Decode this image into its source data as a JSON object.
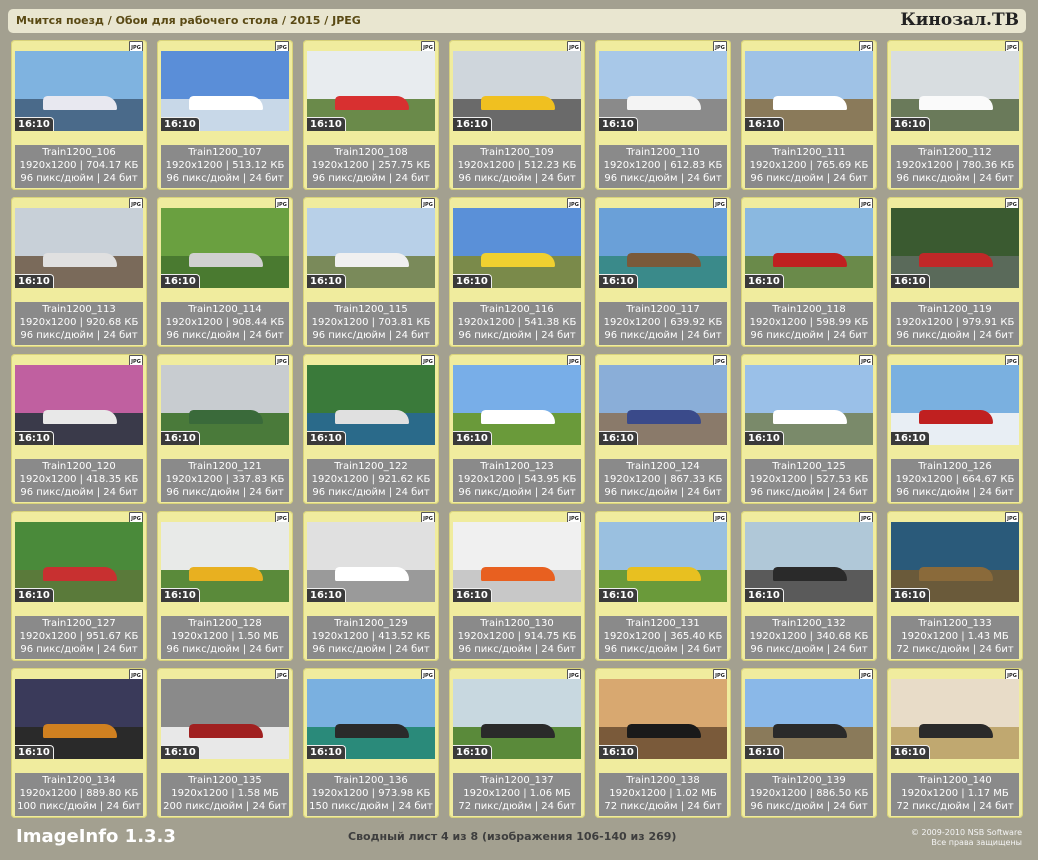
{
  "header": {
    "breadcrumb": "Мчится поезд / Обои для рабочего стола / 2015 / JPEG",
    "brand": "Кинозал.ТВ"
  },
  "tile_common": {
    "aspect_badge": "16:10",
    "format_badge": "JPG"
  },
  "images": [
    {
      "name": "Train1200_106",
      "meta": "1920x1200 | 704.17 КБ",
      "dpi": "96 пикс/дюйм | 24 бит",
      "sky": "#7fb3e0",
      "ground": "#4a6a8a",
      "train": "#e8e8f0"
    },
    {
      "name": "Train1200_107",
      "meta": "1920x1200 | 513.12 КБ",
      "dpi": "96 пикс/дюйм | 24 бит",
      "sky": "#5a8ed8",
      "ground": "#c8d8e8",
      "train": "#ffffff"
    },
    {
      "name": "Train1200_108",
      "meta": "1920x1200 | 257.75 КБ",
      "dpi": "96 пикс/дюйм | 24 бит",
      "sky": "#e8ecef",
      "ground": "#6a8a4a",
      "train": "#d83030"
    },
    {
      "name": "Train1200_109",
      "meta": "1920x1200 | 512.23 КБ",
      "dpi": "96 пикс/дюйм | 24 бит",
      "sky": "#cfd6dc",
      "ground": "#6a6a6a",
      "train": "#f0c020"
    },
    {
      "name": "Train1200_110",
      "meta": "1920x1200 | 612.83 КБ",
      "dpi": "96 пикс/дюйм | 24 бит",
      "sky": "#a8c8e8",
      "ground": "#8a8a8a",
      "train": "#f4f4f4"
    },
    {
      "name": "Train1200_111",
      "meta": "1920x1200 | 765.69 КБ",
      "dpi": "96 пикс/дюйм | 24 бит",
      "sky": "#9fc2e6",
      "ground": "#8a7a5a",
      "train": "#ffffff"
    },
    {
      "name": "Train1200_112",
      "meta": "1920x1200 | 780.36 КБ",
      "dpi": "96 пикс/дюйм | 24 бит",
      "sky": "#d8dde0",
      "ground": "#6a7a5a",
      "train": "#fafafa"
    },
    {
      "name": "Train1200_113",
      "meta": "1920x1200 | 920.68 КБ",
      "dpi": "96 пикс/дюйм | 24 бит",
      "sky": "#c8d0d8",
      "ground": "#7a6a5a",
      "train": "#e0e0e0"
    },
    {
      "name": "Train1200_114",
      "meta": "1920x1200 | 908.44 КБ",
      "dpi": "96 пикс/дюйм | 24 бит",
      "sky": "#6aa040",
      "ground": "#4a7a30",
      "train": "#d0d0d0"
    },
    {
      "name": "Train1200_115",
      "meta": "1920x1200 | 703.81 КБ",
      "dpi": "96 пикс/дюйм | 24 бит",
      "sky": "#b8d0e8",
      "ground": "#7a8a5a",
      "train": "#f0f0f0"
    },
    {
      "name": "Train1200_116",
      "meta": "1920x1200 | 541.38 КБ",
      "dpi": "96 пикс/дюйм | 24 бит",
      "sky": "#5a90d8",
      "ground": "#7a8a4a",
      "train": "#f0d030"
    },
    {
      "name": "Train1200_117",
      "meta": "1920x1200 | 639.92 КБ",
      "dpi": "96 пикс/дюйм | 24 бит",
      "sky": "#6aa0d8",
      "ground": "#3a8a8a",
      "train": "#7a5a3a"
    },
    {
      "name": "Train1200_118",
      "meta": "1920x1200 | 598.99 КБ",
      "dpi": "96 пикс/дюйм | 24 бит",
      "sky": "#8ab8e0",
      "ground": "#6a8a4a",
      "train": "#c02020"
    },
    {
      "name": "Train1200_119",
      "meta": "1920x1200 | 979.91 КБ",
      "dpi": "96 пикс/дюйм | 24 бит",
      "sky": "#3a5a30",
      "ground": "#5a6a5a",
      "train": "#c02828"
    },
    {
      "name": "Train1200_120",
      "meta": "1920x1200 | 418.35 КБ",
      "dpi": "96 пикс/дюйм | 24 бит",
      "sky": "#c060a0",
      "ground": "#3a3a4a",
      "train": "#e8e8e8"
    },
    {
      "name": "Train1200_121",
      "meta": "1920x1200 | 337.83 КБ",
      "dpi": "96 пикс/дюйм | 24 бит",
      "sky": "#c8ccd0",
      "ground": "#4a7a3a",
      "train": "#3a6a3a"
    },
    {
      "name": "Train1200_122",
      "meta": "1920x1200 | 921.62 КБ",
      "dpi": "96 пикс/дюйм | 24 бит",
      "sky": "#3a7a3a",
      "ground": "#2a6a8a",
      "train": "#e0e0e0"
    },
    {
      "name": "Train1200_123",
      "meta": "1920x1200 | 543.95 КБ",
      "dpi": "96 пикс/дюйм | 24 бит",
      "sky": "#78aee8",
      "ground": "#6a9a3a",
      "train": "#ffffff"
    },
    {
      "name": "Train1200_124",
      "meta": "1920x1200 | 867.33 КБ",
      "dpi": "96 пикс/дюйм | 24 бит",
      "sky": "#8aaed8",
      "ground": "#8a7a6a",
      "train": "#3a4a8a"
    },
    {
      "name": "Train1200_125",
      "meta": "1920x1200 | 527.53 КБ",
      "dpi": "96 пикс/дюйм | 24 бит",
      "sky": "#9ac0e8",
      "ground": "#7a8a6a",
      "train": "#ffffff"
    },
    {
      "name": "Train1200_126",
      "meta": "1920x1200 | 664.67 КБ",
      "dpi": "96 пикс/дюйм | 24 бит",
      "sky": "#7ab0e0",
      "ground": "#e8eef4",
      "train": "#c02020"
    },
    {
      "name": "Train1200_127",
      "meta": "1920x1200 | 951.67 КБ",
      "dpi": "96 пикс/дюйм | 24 бит",
      "sky": "#4a8a3a",
      "ground": "#5a7a3a",
      "train": "#c83030"
    },
    {
      "name": "Train1200_128",
      "meta": "1920x1200 | 1.50 МБ",
      "dpi": "96 пикс/дюйм | 24 бит",
      "sky": "#e8eae8",
      "ground": "#5a8a3a",
      "train": "#e8b020"
    },
    {
      "name": "Train1200_129",
      "meta": "1920x1200 | 413.52 КБ",
      "dpi": "96 пикс/дюйм | 24 бит",
      "sky": "#e0e0e0",
      "ground": "#9a9a9a",
      "train": "#ffffff"
    },
    {
      "name": "Train1200_130",
      "meta": "1920x1200 | 914.75 КБ",
      "dpi": "96 пикс/дюйм | 24 бит",
      "sky": "#f0f0f0",
      "ground": "#c8c8c8",
      "train": "#e86020"
    },
    {
      "name": "Train1200_131",
      "meta": "1920x1200 | 365.40 КБ",
      "dpi": "96 пикс/дюйм | 24 бит",
      "sky": "#9ac0e0",
      "ground": "#6a9a3a",
      "train": "#e8c020"
    },
    {
      "name": "Train1200_132",
      "meta": "1920x1200 | 340.68 КБ",
      "dpi": "96 пикс/дюйм | 24 бит",
      "sky": "#b0c8d8",
      "ground": "#5a5a5a",
      "train": "#2a2a2a"
    },
    {
      "name": "Train1200_133",
      "meta": "1920x1200 | 1.43 МБ",
      "dpi": "72 пикс/дюйм | 24 бит",
      "sky": "#2a5a7a",
      "ground": "#6a5a3a",
      "train": "#8a6a3a"
    },
    {
      "name": "Train1200_134",
      "meta": "1920x1200 | 889.80 КБ",
      "dpi": "100 пикс/дюйм | 24 бит",
      "sky": "#3a3a5a",
      "ground": "#2a2a2a",
      "train": "#d08020"
    },
    {
      "name": "Train1200_135",
      "meta": "1920x1200 | 1.58 МБ",
      "dpi": "200 пикс/дюйм | 24 бит",
      "sky": "#8a8a8a",
      "ground": "#e8e8e8",
      "train": "#a02020"
    },
    {
      "name": "Train1200_136",
      "meta": "1920x1200 | 973.98 КБ",
      "dpi": "150 пикс/дюйм | 24 бит",
      "sky": "#7ab0e0",
      "ground": "#2a8a7a",
      "train": "#2a2a2a"
    },
    {
      "name": "Train1200_137",
      "meta": "1920x1200 | 1.06 МБ",
      "dpi": "72 пикс/дюйм | 24 бит",
      "sky": "#c8d8e0",
      "ground": "#5a8a3a",
      "train": "#2a2a2a"
    },
    {
      "name": "Train1200_138",
      "meta": "1920x1200 | 1.02 МБ",
      "dpi": "72 пикс/дюйм | 24 бит",
      "sky": "#d8a870",
      "ground": "#7a5a3a",
      "train": "#1a1a1a"
    },
    {
      "name": "Train1200_139",
      "meta": "1920x1200 | 886.50 КБ",
      "dpi": "96 пикс/дюйм | 24 бит",
      "sky": "#8ab8e8",
      "ground": "#8a7a5a",
      "train": "#2a2a2a"
    },
    {
      "name": "Train1200_140",
      "meta": "1920x1200 | 1.17 МБ",
      "dpi": "72 пикс/дюйм | 24 бит",
      "sky": "#e8dcc8",
      "ground": "#c0a870",
      "train": "#2a2a2a"
    }
  ],
  "footer": {
    "app_name": "ImageInfo 1.3.3",
    "summary": "Сводный лист 4 из 8 (изображения 106-140 из 269)",
    "copyright_line1": "© 2009-2010 NSB Software",
    "copyright_line2": "Все права защищены"
  }
}
